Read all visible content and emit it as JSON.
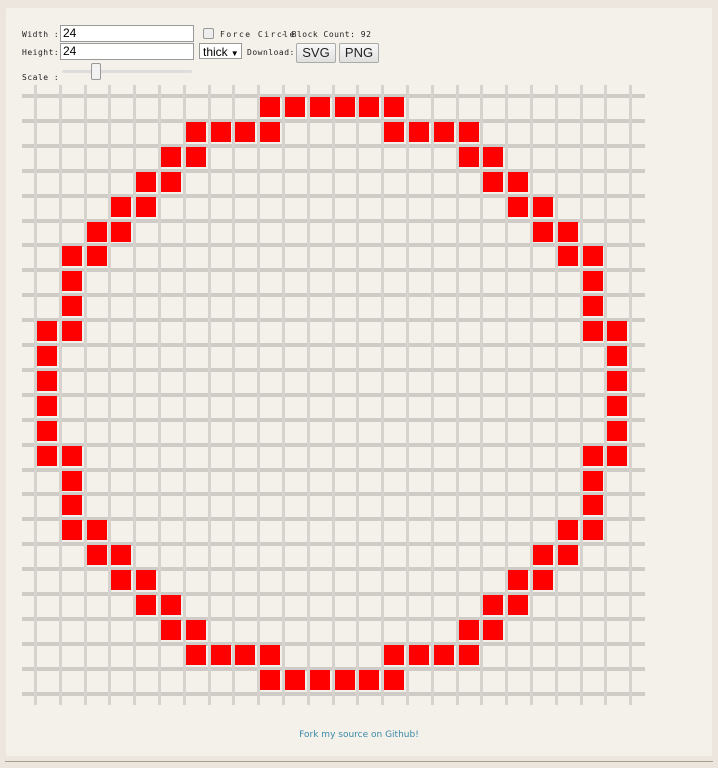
{
  "controls": {
    "width_label": "Width :",
    "width_value": "24",
    "height_label": "Height:",
    "height_value": "24",
    "force_circle_label": "Force Circle",
    "force_circle_checked": false,
    "block_count_text": "- Block Count: 92",
    "thickness_selected": "thick",
    "download_label": "Download:",
    "svg_button": "SVG",
    "png_button": "PNG",
    "scale_label": "Scale :",
    "scale_value_fraction": 0.25
  },
  "grid": {
    "columns": 24,
    "rows": 24,
    "fill_color": "#ff0000",
    "filled_rows": [
      ".........######.........",
      "......####....####......",
      ".....##..........##.....",
      "....##............##....",
      "...##..............##...",
      "..##................##..",
      ".##..................##.",
      ".#....................#.",
      ".#....................#.",
      "##....................##",
      "#......................#",
      "#......................#",
      "#......................#",
      "#......................#",
      "##....................##",
      ".#....................#.",
      ".#....................#.",
      ".##..................##.",
      "..##................##..",
      "...##..............##...",
      "....##............##....",
      ".....##..........##.....",
      "......####....####......",
      ".........######........."
    ]
  },
  "footer": {
    "link_text": "Fork my source on Github!"
  }
}
